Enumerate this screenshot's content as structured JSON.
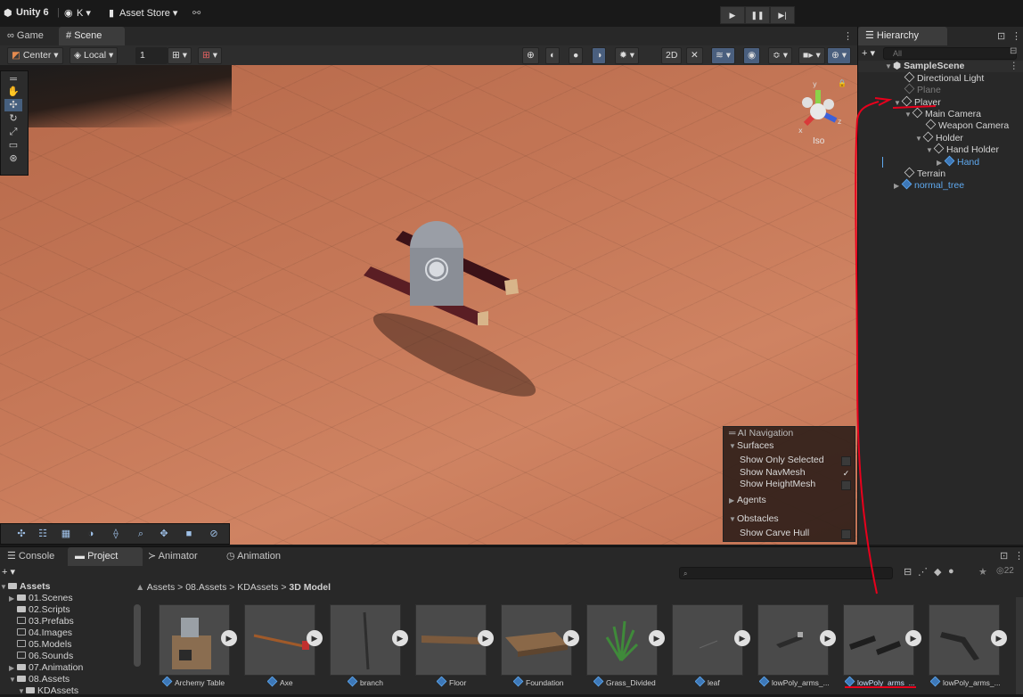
{
  "topbar": {
    "app": "Unity 6",
    "account": "K ▾",
    "asset_store": "Asset Store ▾",
    "play": "▶",
    "pause": "❚❚",
    "step": "▶|"
  },
  "scene_tabs": {
    "game": "Game",
    "scene": "Scene"
  },
  "scene_toolbar": {
    "pivot": "Center ▾",
    "space": "Local ▾",
    "snap_value": "1",
    "mode_2d": "2D",
    "gizmo_label": "Iso"
  },
  "ai_nav": {
    "title": "AI Navigation",
    "surfaces": "Surfaces",
    "show_only_selected": "Show Only Selected",
    "show_navmesh": "Show NavMesh",
    "show_heightmesh": "Show HeightMesh",
    "agents": "Agents",
    "obstacles": "Obstacles",
    "show_carve_hull": "Show Carve Hull",
    "navmesh_check": "✓"
  },
  "hierarchy": {
    "tab": "Hierarchy",
    "search_placeholder": "All",
    "add": "+ ▾",
    "scene": "SampleScene",
    "items": [
      {
        "label": "Directional Light"
      },
      {
        "label": "Plane"
      },
      {
        "label": "Player"
      },
      {
        "label": "Main Camera"
      },
      {
        "label": "Weapon Camera"
      },
      {
        "label": "Holder"
      },
      {
        "label": "Hand Holder"
      },
      {
        "label": "Hand"
      },
      {
        "label": "Terrain"
      },
      {
        "label": "normal_tree"
      }
    ]
  },
  "bottom_tabs": {
    "console": "Console",
    "project": "Project",
    "animator": "Animator",
    "animation": "Animation"
  },
  "project": {
    "add": "+ ▾",
    "breadcrumb": [
      "Assets",
      "08.Assets",
      "KDAssets",
      "3D Model"
    ],
    "hidden_count": "22",
    "tree": [
      {
        "label": "Assets"
      },
      {
        "label": "01.Scenes"
      },
      {
        "label": "02.Scripts"
      },
      {
        "label": "03.Prefabs"
      },
      {
        "label": "04.Images"
      },
      {
        "label": "05.Models"
      },
      {
        "label": "06.Sounds"
      },
      {
        "label": "07.Animation"
      },
      {
        "label": "08.Assets"
      },
      {
        "label": "KDAssets"
      }
    ],
    "assets": [
      {
        "label": "Archemy Table"
      },
      {
        "label": "Axe"
      },
      {
        "label": "branch"
      },
      {
        "label": "Floor"
      },
      {
        "label": "Foundation"
      },
      {
        "label": "Grass_Divided"
      },
      {
        "label": "leaf"
      },
      {
        "label": "lowPoly_arms_..."
      },
      {
        "label": "lowPoly_arms_..."
      },
      {
        "label": "lowPoly_arms_..."
      }
    ]
  },
  "colors": {
    "accent": "#4a5f7e",
    "selection_blue": "#5fa9ef",
    "annotation_red": "#e8001c",
    "ground": "#c47656"
  }
}
